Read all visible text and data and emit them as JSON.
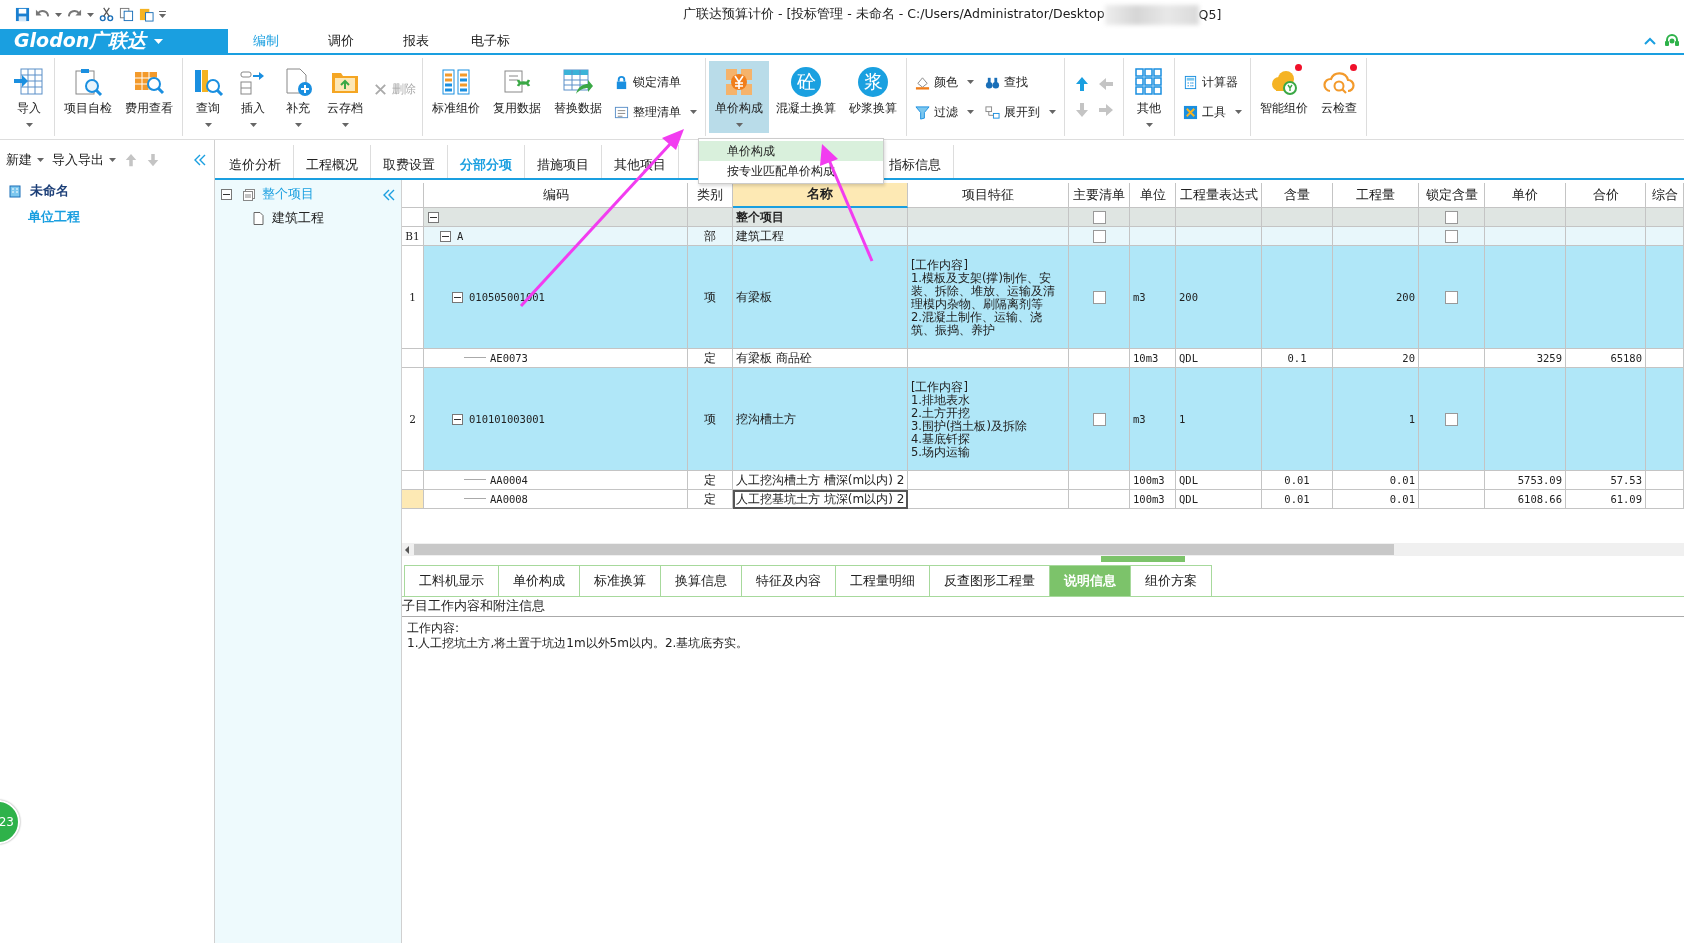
{
  "title_bar": {
    "title": "广联达预算计价 - [投标管理 - 未命名 - C:/Users/Administrator/Desktop",
    "title_end": "Q5]"
  },
  "menu": {
    "logo": "Glodon广联达",
    "tabs": [
      {
        "label": "编制",
        "selected": true
      },
      {
        "label": "调价",
        "selected": false
      },
      {
        "label": "报表",
        "selected": false
      },
      {
        "label": "电子标",
        "selected": false
      }
    ]
  },
  "toolbar": {
    "groups": [
      {
        "items": [
          {
            "kind": "large",
            "label": "导入",
            "dropdown": true,
            "disabled": false,
            "selected": false
          }
        ]
      },
      {
        "items": [
          {
            "kind": "large",
            "label": "项目自检",
            "dropdown": false,
            "disabled": false,
            "selected": false
          },
          {
            "kind": "large",
            "label": "费用查看",
            "dropdown": false,
            "disabled": false,
            "selected": false
          }
        ]
      },
      {
        "items": [
          {
            "kind": "large",
            "label": "查询",
            "dropdown": true,
            "disabled": false,
            "selected": false
          },
          {
            "kind": "large",
            "label": "插入",
            "dropdown": true,
            "disabled": false,
            "selected": false
          },
          {
            "kind": "large",
            "label": "补充",
            "dropdown": true,
            "disabled": false,
            "selected": false
          },
          {
            "kind": "large",
            "label": "云存档",
            "dropdown": true,
            "disabled": false,
            "selected": false
          },
          {
            "kind": "small",
            "label": "删除",
            "dropdown": false,
            "disabled": true
          }
        ]
      },
      {
        "items": [
          {
            "kind": "large",
            "label": "标准组价",
            "dropdown": false,
            "disabled": false,
            "selected": false
          },
          {
            "kind": "large",
            "label": "复用数据",
            "dropdown": false,
            "disabled": false,
            "selected": false
          },
          {
            "kind": "large",
            "label": "替换数据",
            "dropdown": false,
            "disabled": false,
            "selected": false
          },
          {
            "kind": "stack",
            "items": [
              {
                "label": "锁定清单",
                "dropdown": false,
                "disabled": false
              },
              {
                "label": "整理清单",
                "dropdown": true,
                "disabled": false
              }
            ]
          }
        ]
      },
      {
        "items": [
          {
            "kind": "large",
            "label": "单价构成",
            "dropdown": true,
            "disabled": false,
            "selected": true
          },
          {
            "kind": "glyph",
            "icon_text": "砼",
            "label": "混凝土换算",
            "dropdown": false,
            "disabled": false,
            "selected": false
          },
          {
            "kind": "glyph",
            "icon_text": "浆",
            "label": "砂浆换算",
            "dropdown": false,
            "disabled": false,
            "selected": false
          }
        ]
      },
      {
        "items": [
          {
            "kind": "stack",
            "items": [
              {
                "label": "颜色",
                "dropdown": true,
                "disabled": false
              },
              {
                "label": "过滤",
                "dropdown": true,
                "disabled": false
              }
            ]
          },
          {
            "kind": "stack",
            "items": [
              {
                "label": "查找",
                "dropdown": false,
                "disabled": false
              },
              {
                "label": "展开到",
                "dropdown": true,
                "disabled": false
              }
            ]
          }
        ]
      },
      {
        "items": [
          {
            "kind": "arrows",
            "items": [
              {
                "disabled": false
              },
              {
                "disabled": true
              },
              {
                "disabled": true
              },
              {
                "disabled": true
              }
            ]
          }
        ]
      },
      {
        "items": [
          {
            "kind": "large",
            "label": "其他",
            "dropdown": true,
            "disabled": false,
            "selected": false
          }
        ]
      },
      {
        "items": [
          {
            "kind": "stack",
            "items": [
              {
                "label": "计算器",
                "dropdown": false,
                "disabled": false
              },
              {
                "label": "工具",
                "dropdown": true,
                "disabled": false
              }
            ]
          }
        ]
      },
      {
        "items": [
          {
            "kind": "large",
            "label": "智能组价",
            "dropdown": false,
            "disabled": false,
            "selected": false,
            "notification": true
          },
          {
            "kind": "large",
            "label": "云检查",
            "dropdown": false,
            "disabled": false,
            "selected": false,
            "notification": true
          }
        ]
      }
    ]
  },
  "left_panel": {
    "actions": [
      {
        "label": "新建",
        "dropdown": true
      },
      {
        "label": "导入导出",
        "dropdown": true
      }
    ],
    "tree": [
      {
        "label": "未命名",
        "selected": false,
        "children": [
          {
            "label": "单位工程",
            "selected": true
          }
        ]
      }
    ]
  },
  "tabs": [
    {
      "label": "造价分析",
      "selected": false
    },
    {
      "label": "工程概况",
      "selected": false
    },
    {
      "label": "取费设置",
      "selected": false
    },
    {
      "label": "分部分项",
      "selected": true
    },
    {
      "label": "措施项目",
      "selected": false
    },
    {
      "label": "其他项目",
      "selected": false
    },
    {
      "label": "指标信息",
      "selected": false
    }
  ],
  "dropdown_menu": {
    "items": [
      {
        "label": "单价构成",
        "selected": true
      },
      {
        "label": "按专业匹配单价构成",
        "selected": false
      }
    ]
  },
  "project_tree": [
    {
      "label": "整个项目",
      "selected": true,
      "expanded": true,
      "children": [
        {
          "label": "建筑工程",
          "selected": false
        }
      ]
    }
  ],
  "grid": {
    "columns": [
      {
        "label": "编码",
        "selected": false
      },
      {
        "label": "类别",
        "selected": false
      },
      {
        "label": "名称",
        "selected": true
      },
      {
        "label": "项目特征",
        "selected": false
      },
      {
        "label": "主要清单",
        "selected": false
      },
      {
        "label": "单位",
        "selected": false
      },
      {
        "label": "工程量表达式",
        "selected": false
      },
      {
        "label": "含量",
        "selected": false
      },
      {
        "label": "工程量",
        "selected": false
      },
      {
        "label": "锁定含量",
        "selected": false
      },
      {
        "label": "单价",
        "selected": false
      },
      {
        "label": "合价",
        "selected": false
      },
      {
        "label": "综合",
        "selected": false
      }
    ],
    "rows": [
      {
        "kind": "root",
        "name": "整个项目",
        "expanded": true,
        "selected": false,
        "main_list": {
          "checked": false
        },
        "lock": {
          "checked": false
        },
        "children": [
          {
            "kind": "section",
            "number": "B1",
            "code": "A",
            "type": "部",
            "name": "建筑工程",
            "expanded": true,
            "selected": false,
            "main_list": {
              "checked": false
            },
            "lock": {
              "checked": false
            },
            "children": [
              {
                "kind": "item",
                "number": "1",
                "code": "010505001001",
                "type": "项",
                "name": "有梁板",
                "features": "[工作内容]\n1.模板及支架(撑)制作、安装、拆除、堆放、运输及清理模内杂物、刷隔离剂等\n2.混凝土制作、运输、浇筑、振捣、养护",
                "unit": "m3",
                "expr": "200",
                "quantity": "200",
                "expanded": true,
                "selected": false,
                "main_list": {
                  "checked": false
                },
                "lock": {
                  "checked": false
                },
                "children": [
                  {
                    "kind": "quota",
                    "code": "AE0073",
                    "type": "定",
                    "name": "有梁板 商品砼",
                    "unit": "10m3",
                    "expr": "QDL",
                    "content": "0.1",
                    "quantity": "20",
                    "price": "3259",
                    "total": "65180",
                    "selected": false
                  }
                ]
              },
              {
                "kind": "item",
                "number": "2",
                "code": "010101003001",
                "type": "项",
                "name": "挖沟槽土方",
                "features": "[工作内容]\n1.排地表水\n2.土方开挖\n3.围护(挡土板)及拆除\n4.基底钎探\n5.场内运输",
                "unit": "m3",
                "expr": "1",
                "quantity": "1",
                "expanded": true,
                "selected": false,
                "main_list": {
                  "checked": false
                },
                "lock": {
                  "checked": false
                },
                "children": [
                  {
                    "kind": "quota",
                    "code": "AA0004",
                    "type": "定",
                    "name": "人工挖沟槽土方 槽深(m以内) 2",
                    "unit": "100m3",
                    "expr": "QDL",
                    "content": "0.01",
                    "quantity": "0.01",
                    "price": "5753.09",
                    "total": "57.53",
                    "selected": false
                  },
                  {
                    "kind": "quota",
                    "code": "AA0008",
                    "type": "定",
                    "name": "人工挖基坑土方 坑深(m以内) 2",
                    "unit": "100m3",
                    "expr": "QDL",
                    "content": "0.01",
                    "quantity": "0.01",
                    "price": "6108.66",
                    "total": "61.09",
                    "selected": true
                  }
                ]
              }
            ]
          }
        ]
      }
    ]
  },
  "bottom_tabs": [
    {
      "label": "工料机显示",
      "selected": false
    },
    {
      "label": "单价构成",
      "selected": false
    },
    {
      "label": "标准换算",
      "selected": false
    },
    {
      "label": "换算信息",
      "selected": false
    },
    {
      "label": "特征及内容",
      "selected": false
    },
    {
      "label": "工程量明细",
      "selected": false
    },
    {
      "label": "反查图形工程量",
      "selected": false
    },
    {
      "label": "说明信息",
      "selected": true
    },
    {
      "label": "组价方案",
      "selected": false
    }
  ],
  "info": {
    "heading": "子目工作内容和附注信息",
    "lines": [
      "工作内容:",
      "1.人工挖坑土方,将土置于坑边1m以外5m以内。2.基坑底夯实。"
    ]
  },
  "floating_badge": {
    "text": "23"
  },
  "annotations": [
    {
      "kind": "arrow"
    },
    {
      "kind": "arrow"
    }
  ]
}
